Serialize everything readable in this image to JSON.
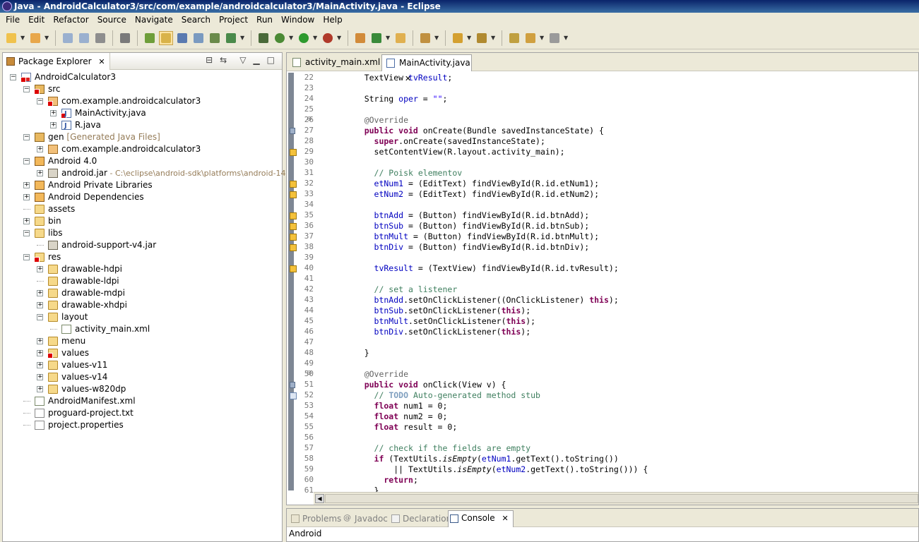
{
  "window": {
    "title": "Java - AndroidCalculator3/src/com/example/androidcalculator3/MainActivity.java - Eclipse"
  },
  "menu": [
    "File",
    "Edit",
    "Refactor",
    "Source",
    "Navigate",
    "Search",
    "Project",
    "Run",
    "Window",
    "Help"
  ],
  "toolbar": {
    "icons": [
      "new-wizard-icon",
      "new-java-project-icon",
      "save-icon",
      "save-all-icon",
      "print-icon",
      "skip-breakpoints-icon",
      "new-android-project-icon",
      "mark-occurrences-icon",
      "build-icon",
      "open-type-icon",
      "open-task-icon",
      "tasks-icon",
      "android-sdk-manager-icon",
      "debug-icon",
      "run-icon",
      "run-external-tools-icon",
      "new-java-package-icon",
      "new-java-class-icon",
      "open-resource-icon",
      "search-icon",
      "next-annotation-icon",
      "previous-annotation-icon",
      "last-edit-icon",
      "back-icon",
      "forward-icon"
    ]
  },
  "package_explorer": {
    "title": "Package Explorer",
    "items": [
      {
        "label": "AndroidCalculator3",
        "level": 0,
        "icon": "project-icon",
        "expanded": true,
        "error": true
      },
      {
        "label": "src",
        "level": 1,
        "icon": "source-folder-icon",
        "expanded": true,
        "error": true
      },
      {
        "label": "com.example.androidcalculator3",
        "level": 2,
        "icon": "package-icon",
        "expanded": true,
        "error": true
      },
      {
        "label": "MainActivity.java",
        "level": 3,
        "icon": "java-file-icon",
        "collapsed": true,
        "error": true
      },
      {
        "label": "R.java",
        "level": 3,
        "icon": "java-file-icon",
        "collapsed": true
      },
      {
        "label": "gen",
        "decoration": "[Generated Java Files]",
        "level": 1,
        "icon": "source-folder-icon",
        "expanded": true
      },
      {
        "label": "com.example.androidcalculator3",
        "level": 2,
        "icon": "package-icon",
        "collapsed": true
      },
      {
        "label": "Android 4.0",
        "level": 1,
        "icon": "library-icon",
        "expanded": true
      },
      {
        "label": "android.jar",
        "decoration": " - C:\\eclipse\\android-sdk\\platforms\\android-14",
        "level": 2,
        "icon": "jar-icon",
        "collapsed": true
      },
      {
        "label": "Android Private Libraries",
        "level": 1,
        "icon": "library-icon",
        "collapsed": true
      },
      {
        "label": "Android Dependencies",
        "level": 1,
        "icon": "library-icon",
        "collapsed": true
      },
      {
        "label": "assets",
        "level": 1,
        "icon": "folder-icon"
      },
      {
        "label": "bin",
        "level": 1,
        "icon": "folder-icon",
        "collapsed": true
      },
      {
        "label": "libs",
        "level": 1,
        "icon": "folder-icon",
        "expanded": true
      },
      {
        "label": "android-support-v4.jar",
        "level": 2,
        "icon": "jar-icon"
      },
      {
        "label": "res",
        "level": 1,
        "icon": "folder-icon",
        "expanded": true,
        "error": true
      },
      {
        "label": "drawable-hdpi",
        "level": 2,
        "icon": "folder-icon",
        "collapsed": true
      },
      {
        "label": "drawable-ldpi",
        "level": 2,
        "icon": "folder-icon"
      },
      {
        "label": "drawable-mdpi",
        "level": 2,
        "icon": "folder-icon",
        "collapsed": true
      },
      {
        "label": "drawable-xhdpi",
        "level": 2,
        "icon": "folder-icon",
        "collapsed": true
      },
      {
        "label": "layout",
        "level": 2,
        "icon": "folder-icon",
        "expanded": true
      },
      {
        "label": "activity_main.xml",
        "level": 3,
        "icon": "xml-file-icon"
      },
      {
        "label": "menu",
        "level": 2,
        "icon": "folder-icon",
        "collapsed": true
      },
      {
        "label": "values",
        "level": 2,
        "icon": "folder-icon",
        "collapsed": true,
        "error": true
      },
      {
        "label": "values-v11",
        "level": 2,
        "icon": "folder-icon",
        "collapsed": true
      },
      {
        "label": "values-v14",
        "level": 2,
        "icon": "folder-icon",
        "collapsed": true
      },
      {
        "label": "values-w820dp",
        "level": 2,
        "icon": "folder-icon",
        "collapsed": true
      },
      {
        "label": "AndroidManifest.xml",
        "level": 1,
        "icon": "xml-file-icon"
      },
      {
        "label": "proguard-project.txt",
        "level": 1,
        "icon": "file-icon"
      },
      {
        "label": "project.properties",
        "level": 1,
        "icon": "file-icon"
      }
    ]
  },
  "editor": {
    "tabs": [
      {
        "label": "activity_main.xml",
        "active": false
      },
      {
        "label": "MainActivity.java",
        "active": true
      }
    ],
    "lines": [
      {
        "n": "22",
        "code": [
          [
            "",
            "    TextView "
          ],
          [
            "fld",
            "tvResult"
          ],
          [
            "",
            ";"
          ]
        ]
      },
      {
        "n": "23",
        "code": []
      },
      {
        "n": "24",
        "code": [
          [
            "",
            "    String "
          ],
          [
            "fld",
            "oper"
          ],
          [
            "",
            " = "
          ],
          [
            "str",
            "\"\""
          ],
          [
            "",
            ";"
          ]
        ]
      },
      {
        "n": "25",
        "code": []
      },
      {
        "n": "26",
        "fold": true,
        "code": [
          [
            "ann",
            "    @Override"
          ]
        ]
      },
      {
        "n": "27",
        "marker": "override",
        "code": [
          [
            "kw",
            "    public void "
          ],
          [
            "",
            "onCreate(Bundle "
          ],
          [
            "",
            "savedInstanceState) {"
          ]
        ]
      },
      {
        "n": "28",
        "code": [
          [
            "kw",
            "      super"
          ],
          [
            "",
            ".onCreate("
          ],
          [
            "",
            "savedInstanceState);"
          ]
        ]
      },
      {
        "n": "29",
        "marker": "err",
        "code": [
          [
            "",
            "      setContentView(R."
          ],
          [
            "",
            "layout"
          ],
          [
            "",
            "."
          ],
          [
            "",
            "activity_main"
          ],
          [
            "",
            ");"
          ]
        ]
      },
      {
        "n": "30",
        "code": []
      },
      {
        "n": "31",
        "code": [
          [
            "cm",
            "      // Poisk elementov"
          ]
        ]
      },
      {
        "n": "32",
        "marker": "err",
        "code": [
          [
            "fld",
            "      etNum1"
          ],
          [
            "",
            " = (EditText) findViewById(R."
          ],
          [
            "",
            "id"
          ],
          [
            "",
            "."
          ],
          [
            "",
            "etNum1);"
          ]
        ]
      },
      {
        "n": "33",
        "marker": "err",
        "code": [
          [
            "fld",
            "      etNum2"
          ],
          [
            "",
            " = (EditText) findViewById(R."
          ],
          [
            "",
            "id"
          ],
          [
            "",
            "."
          ],
          [
            "",
            "etNum2);"
          ]
        ]
      },
      {
        "n": "34",
        "code": []
      },
      {
        "n": "35",
        "marker": "err",
        "code": [
          [
            "fld",
            "      btnAdd"
          ],
          [
            "",
            " = (Button) findViewById(R."
          ],
          [
            "",
            "id"
          ],
          [
            "",
            ".btnAdd);"
          ]
        ]
      },
      {
        "n": "36",
        "marker": "err",
        "code": [
          [
            "fld",
            "      btnSub"
          ],
          [
            "",
            " = (Button) findViewById(R."
          ],
          [
            "",
            "id"
          ],
          [
            "",
            ".btnSub);"
          ]
        ]
      },
      {
        "n": "37",
        "marker": "err",
        "code": [
          [
            "fld",
            "      btnMult"
          ],
          [
            "",
            " = (Button) findViewById(R."
          ],
          [
            "",
            "id"
          ],
          [
            "",
            ".btnMult);"
          ]
        ]
      },
      {
        "n": "38",
        "marker": "err",
        "code": [
          [
            "fld",
            "      btnDiv"
          ],
          [
            "",
            " = (Button) findViewById(R."
          ],
          [
            "",
            "id"
          ],
          [
            "",
            ".btnDiv);"
          ]
        ]
      },
      {
        "n": "39",
        "code": []
      },
      {
        "n": "40",
        "marker": "err",
        "code": [
          [
            "fld",
            "      tvResult"
          ],
          [
            "",
            " = (TextView) findViewById(R."
          ],
          [
            "",
            "id"
          ],
          [
            "",
            ".tvResult);"
          ]
        ]
      },
      {
        "n": "41",
        "code": []
      },
      {
        "n": "42",
        "code": [
          [
            "cm",
            "      // set a listener"
          ]
        ]
      },
      {
        "n": "43",
        "code": [
          [
            "fld",
            "      btnAdd"
          ],
          [
            "",
            ".setOnClickListener((OnClickListener) "
          ],
          [
            "kw",
            "this"
          ],
          [
            "",
            ");"
          ]
        ]
      },
      {
        "n": "44",
        "code": [
          [
            "fld",
            "      btnSub"
          ],
          [
            "",
            ".setOnClickListener("
          ],
          [
            "kw",
            "this"
          ],
          [
            "",
            ");"
          ]
        ]
      },
      {
        "n": "45",
        "code": [
          [
            "fld",
            "      btnMult"
          ],
          [
            "",
            ".setOnClickListener("
          ],
          [
            "kw",
            "this"
          ],
          [
            "",
            ");"
          ]
        ]
      },
      {
        "n": "46",
        "code": [
          [
            "fld",
            "      btnDiv"
          ],
          [
            "",
            ".setOnClickListener("
          ],
          [
            "kw",
            "this"
          ],
          [
            "",
            ");"
          ]
        ]
      },
      {
        "n": "47",
        "code": []
      },
      {
        "n": "48",
        "code": [
          [
            "",
            "    }"
          ]
        ]
      },
      {
        "n": "49",
        "code": []
      },
      {
        "n": "50",
        "fold": true,
        "code": [
          [
            "ann",
            "    @Override"
          ]
        ]
      },
      {
        "n": "51",
        "marker": "override",
        "code": [
          [
            "kw",
            "    public void "
          ],
          [
            "",
            "onClick(View v) {"
          ]
        ]
      },
      {
        "n": "52",
        "marker": "task",
        "code": [
          [
            "cm",
            "      // "
          ],
          [
            "cmb",
            "TODO"
          ],
          [
            "cm",
            " Auto-generated method stub"
          ]
        ]
      },
      {
        "n": "53",
        "code": [
          [
            "kw",
            "      float "
          ],
          [
            "",
            "num1 = 0;"
          ]
        ]
      },
      {
        "n": "54",
        "code": [
          [
            "kw",
            "      float "
          ],
          [
            "",
            "num2 = 0;"
          ]
        ]
      },
      {
        "n": "55",
        "code": [
          [
            "kw",
            "      float "
          ],
          [
            "",
            "result = 0;"
          ]
        ]
      },
      {
        "n": "56",
        "code": []
      },
      {
        "n": "57",
        "code": [
          [
            "cm",
            "      // check if the fields are empty"
          ]
        ]
      },
      {
        "n": "58",
        "code": [
          [
            "kw",
            "      if "
          ],
          [
            "",
            "(TextUtils."
          ],
          [
            "it",
            "isEmpty"
          ],
          [
            "",
            "("
          ],
          [
            "fld",
            "etNum1"
          ],
          [
            "",
            ".getText().toString())"
          ]
        ]
      },
      {
        "n": "59",
        "code": [
          [
            "",
            "          || TextUtils."
          ],
          [
            "it",
            "isEmpty"
          ],
          [
            "",
            "("
          ],
          [
            "fld",
            "etNum2"
          ],
          [
            "",
            ".getText().toString())) {"
          ]
        ]
      },
      {
        "n": "60",
        "code": [
          [
            "kw",
            "        return"
          ],
          [
            "",
            ";"
          ]
        ]
      },
      {
        "n": "61",
        "code": [
          [
            "",
            "      }"
          ]
        ]
      }
    ]
  },
  "bottom_panel": {
    "tabs": [
      {
        "label": "Problems",
        "active": false
      },
      {
        "label": "Javadoc",
        "active": false
      },
      {
        "label": "Declaration",
        "active": false
      },
      {
        "label": "Console",
        "active": true
      }
    ],
    "console_label": "Android"
  }
}
